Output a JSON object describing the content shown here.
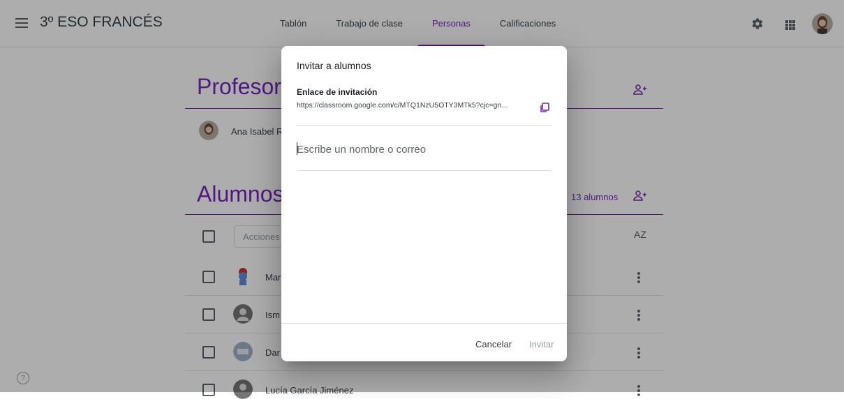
{
  "header": {
    "class_name": "3º ESO FRANCÉS",
    "tabs": [
      {
        "label": "Tablón"
      },
      {
        "label": "Trabajo de clase"
      },
      {
        "label": "Personas",
        "active": true
      },
      {
        "label": "Calificaciones"
      }
    ],
    "icons": [
      "menu-icon",
      "gear-icon",
      "apps-icon",
      "account-avatar"
    ]
  },
  "teachers": {
    "title": "Profesores",
    "list": [
      {
        "name": "Ana Isabel R"
      }
    ]
  },
  "students": {
    "title": "Alumnos",
    "count_label": "13 alumnos",
    "actions_label": "Acciones",
    "sort_icon": "AZ",
    "list": [
      {
        "name": "Mar"
      },
      {
        "name": "Ism"
      },
      {
        "name": "Dar"
      },
      {
        "name": "Lucía García Jiménez"
      }
    ]
  },
  "dialog": {
    "title": "Invitar a alumnos",
    "invite_link_label": "Enlace de invitación",
    "invite_link_url": "https://classroom.google.com/c/MTQ1NzU5OTY3MTk5?cjc=gn…",
    "input_placeholder": "Escribe un nombre o correo",
    "cancel_label": "Cancelar",
    "invite_label": "Invitar"
  },
  "colors": {
    "accent": "#7627bb",
    "scrim": "rgba(0,0,0,0.32)"
  }
}
